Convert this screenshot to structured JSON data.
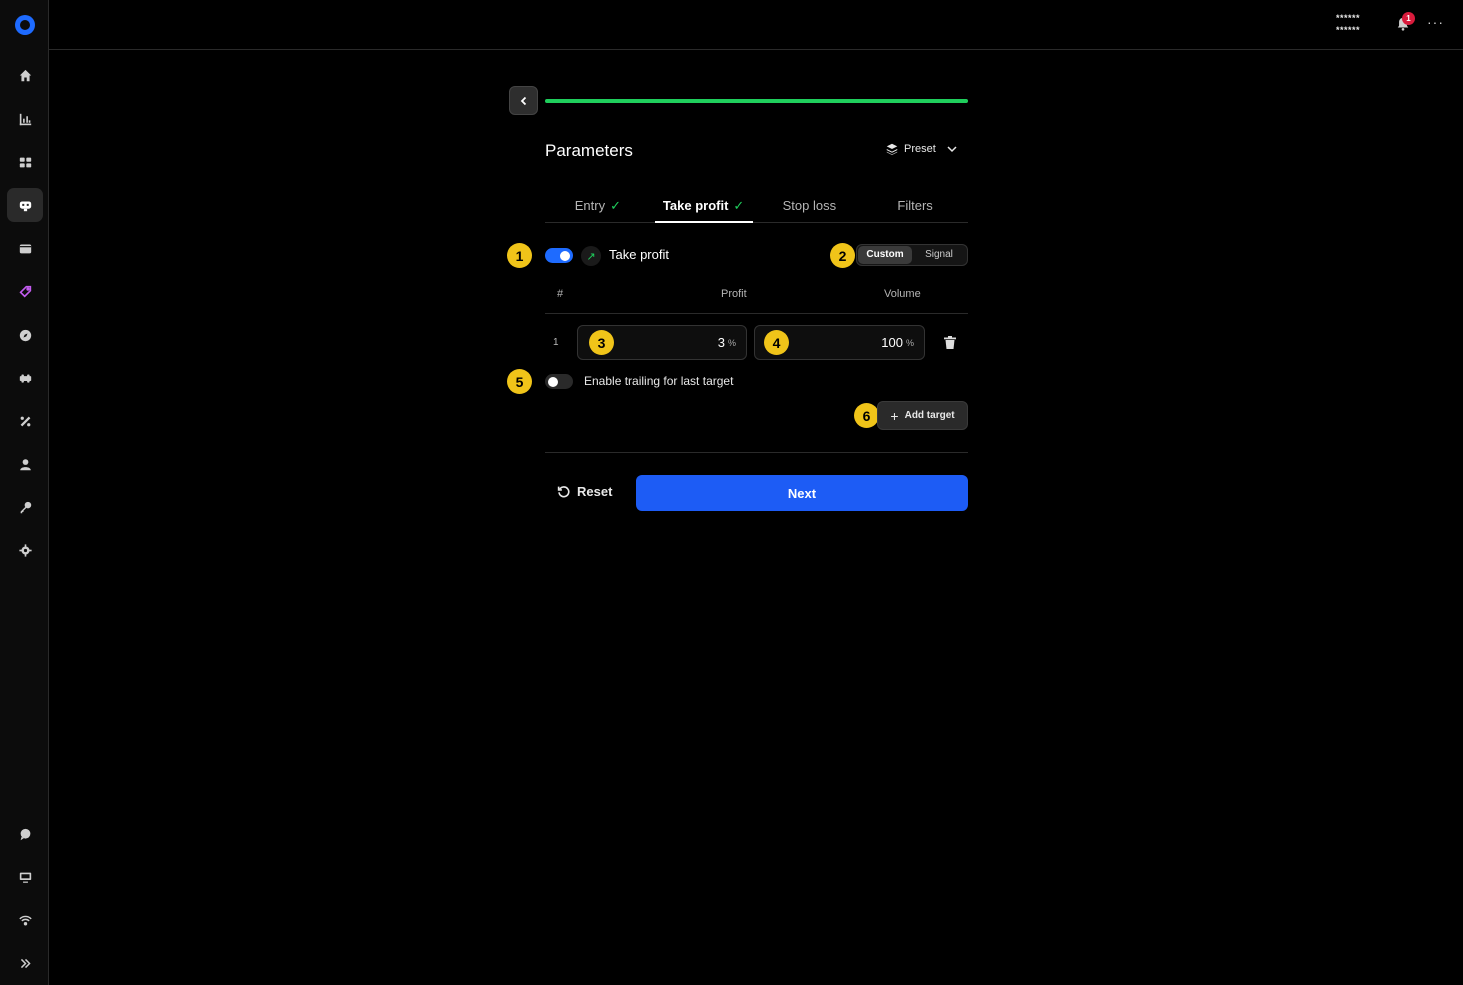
{
  "header": {
    "user_line1": "******",
    "user_line2": "******",
    "notification_count": "1",
    "more_label": "···"
  },
  "sidebar": {
    "items": [
      {
        "icon": "home-icon"
      },
      {
        "icon": "chart-icon"
      },
      {
        "icon": "grid-icon"
      },
      {
        "icon": "bot-icon",
        "active": true
      },
      {
        "icon": "wallet-icon"
      },
      {
        "icon": "tag-icon"
      },
      {
        "icon": "compass-icon"
      },
      {
        "icon": "puzzle-icon"
      },
      {
        "icon": "percent-icon"
      },
      {
        "icon": "user-icon"
      },
      {
        "icon": "key-icon"
      },
      {
        "icon": "gear-icon"
      }
    ],
    "bottom_items": [
      {
        "icon": "chat-icon"
      },
      {
        "icon": "monitor-icon"
      },
      {
        "icon": "wifi-icon"
      },
      {
        "icon": "expand-icon"
      }
    ]
  },
  "wizard": {
    "progress": 1.0,
    "title": "Parameters",
    "preset_label": "Preset",
    "tabs": [
      {
        "label": "Entry",
        "done": true
      },
      {
        "label": "Take profit",
        "done": true,
        "active": true
      },
      {
        "label": "Stop loss",
        "done": false
      },
      {
        "label": "Filters",
        "done": false
      }
    ]
  },
  "take_profit": {
    "enabled": true,
    "label": "Take profit",
    "mode_options": [
      "Custom",
      "Signal"
    ],
    "mode_selected": "Custom",
    "columns": {
      "num": "#",
      "profit": "Profit",
      "volume": "Volume"
    },
    "targets": [
      {
        "num": "1",
        "profit": "3",
        "profit_unit": "%",
        "volume": "100",
        "volume_unit": "%"
      }
    ],
    "trailing_enabled": false,
    "trailing_label": "Enable trailing for last target",
    "add_target_label": "Add target"
  },
  "markers": [
    "1",
    "2",
    "3",
    "4",
    "5",
    "6"
  ],
  "footer": {
    "reset_label": "Reset",
    "next_label": "Next"
  },
  "colors": {
    "accent_blue": "#1d5cf5",
    "success_green": "#1fce5c",
    "marker_yellow": "#f0c419",
    "badge_red": "#d81b3c"
  }
}
